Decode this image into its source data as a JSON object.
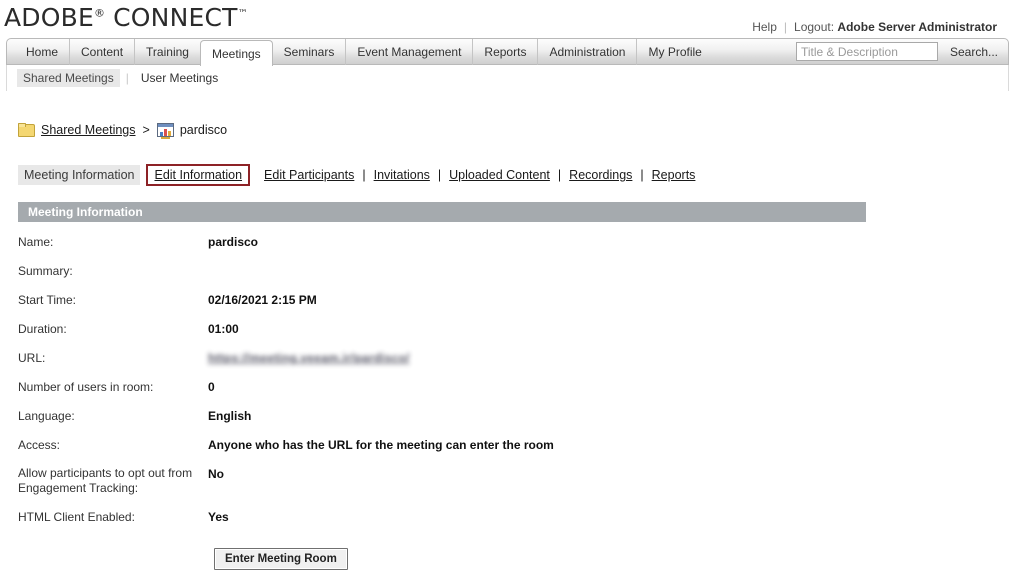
{
  "brand": {
    "word1": "ADOBE",
    "registered": "®",
    "word2": "CONNECT",
    "trademark": "™"
  },
  "account": {
    "help_label": "Help",
    "logout_label": "Logout:",
    "user_name": "Adobe Server Administrator"
  },
  "nav": {
    "tabs": [
      {
        "label": "Home",
        "active": false
      },
      {
        "label": "Content",
        "active": false
      },
      {
        "label": "Training",
        "active": false
      },
      {
        "label": "Meetings",
        "active": true
      },
      {
        "label": "Seminars",
        "active": false
      },
      {
        "label": "Event Management",
        "active": false
      },
      {
        "label": "Reports",
        "active": false
      },
      {
        "label": "Administration",
        "active": false
      },
      {
        "label": "My Profile",
        "active": false
      }
    ]
  },
  "search": {
    "placeholder": "Title & Description",
    "value": "",
    "link_label": "Search..."
  },
  "subnav": {
    "items": [
      {
        "label": "Shared Meetings",
        "active": true
      },
      {
        "label": "User Meetings",
        "active": false
      }
    ],
    "separator": "|"
  },
  "breadcrumb": {
    "folder_icon": "folder-icon",
    "root_label": "Shared Meetings",
    "arrow": ">",
    "meeting_icon": "meeting-room-icon",
    "current_label": "pardisco"
  },
  "section_tabs": {
    "separator": "|",
    "items": [
      {
        "label": "Meeting Information",
        "state": "current"
      },
      {
        "label": "Edit Information",
        "state": "boxed"
      },
      {
        "label": "Edit Participants",
        "state": "link"
      },
      {
        "label": "Invitations",
        "state": "link"
      },
      {
        "label": "Uploaded Content",
        "state": "link"
      },
      {
        "label": "Recordings",
        "state": "link"
      },
      {
        "label": "Reports",
        "state": "link"
      }
    ]
  },
  "panel": {
    "title": "Meeting Information",
    "rows": [
      {
        "label": "Name:",
        "value": "pardisco"
      },
      {
        "label": "Summary:",
        "value": ""
      },
      {
        "label": "Start Time:",
        "value": "02/16/2021 2:15 PM"
      },
      {
        "label": "Duration:",
        "value": "01:00"
      },
      {
        "label": "URL:",
        "value": "https://meeting.veeam.ir/pardisco/",
        "redacted": true
      },
      {
        "label": "Number of users in room:",
        "value": "0"
      },
      {
        "label": "Language:",
        "value": "English"
      },
      {
        "label": "Access:",
        "value": "Anyone who has the URL for the meeting can enter the room"
      },
      {
        "label": "Allow participants to opt out from Engagement Tracking:",
        "value": "No"
      },
      {
        "label": "HTML Client Enabled:",
        "value": "Yes"
      }
    ],
    "enter_room_label": "Enter Meeting Room"
  },
  "colors": {
    "panel_header_bg": "#a5aaae",
    "highlight_box_border": "#8d2226",
    "active_subnav_bg": "#e8e8e8",
    "folder_yellow": "#f4d772"
  }
}
